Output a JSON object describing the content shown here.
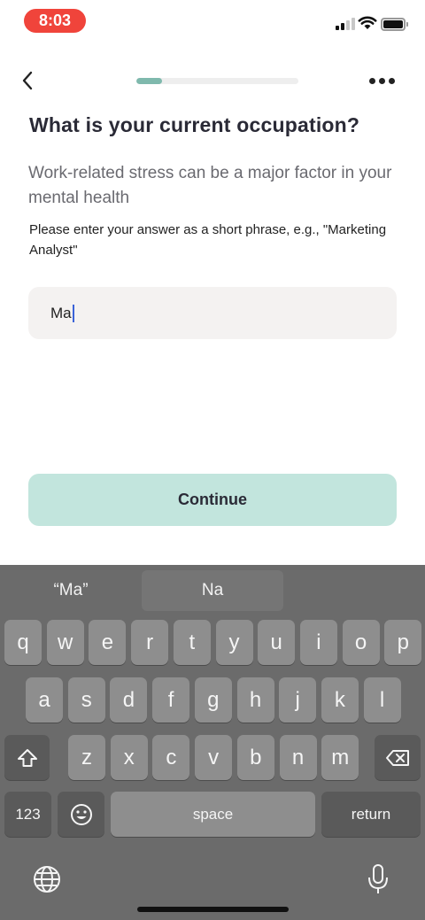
{
  "status_bar": {
    "time": "8:03"
  },
  "nav": {
    "progress": 0.16
  },
  "question": {
    "title": "What is your current occupation?",
    "subtitle": "Work-related stress can be a major factor in your mental health",
    "hint": "Please enter your answer as a short phrase, e.g., \"Marketing Analyst\""
  },
  "answer": {
    "value": "Ma"
  },
  "continue_label": "Continue",
  "keyboard": {
    "suggestions": [
      "“Ma”",
      "Na",
      ""
    ],
    "row1": [
      "q",
      "w",
      "e",
      "r",
      "t",
      "y",
      "u",
      "i",
      "o",
      "p"
    ],
    "row2": [
      "a",
      "s",
      "d",
      "f",
      "g",
      "h",
      "j",
      "k",
      "l"
    ],
    "row3": [
      "z",
      "x",
      "c",
      "v",
      "b",
      "n",
      "m"
    ],
    "numbers_label": "123",
    "space_label": "space",
    "return_label": "return"
  },
  "colors": {
    "accent": "#7fb9ad",
    "button_bg": "#c2e5dd",
    "time_pill": "#f0443b"
  }
}
